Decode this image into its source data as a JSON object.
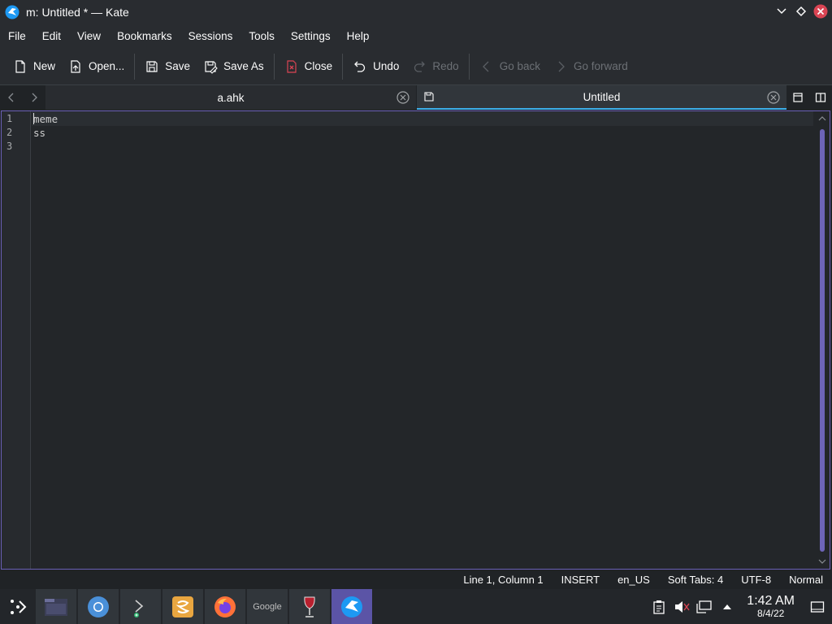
{
  "window": {
    "title": "m: Untitled * — Kate",
    "app_icon": "kate-icon"
  },
  "menu": [
    "File",
    "Edit",
    "View",
    "Bookmarks",
    "Sessions",
    "Tools",
    "Settings",
    "Help"
  ],
  "toolbar": {
    "new_label": "New",
    "open_label": "Open...",
    "save_label": "Save",
    "save_as_label": "Save As",
    "close_label": "Close",
    "undo_label": "Undo",
    "redo_label": "Redo",
    "go_back_label": "Go back",
    "go_forward_label": "Go forward"
  },
  "tabs": [
    {
      "label": "a.ahk",
      "active": false
    },
    {
      "label": "Untitled",
      "active": true,
      "modified": true
    }
  ],
  "editor": {
    "line_numbers": [
      "1",
      "2",
      "3"
    ],
    "lines": [
      "meme",
      "ss",
      ""
    ]
  },
  "status": {
    "position": "Line 1, Column 1",
    "mode": "INSERT",
    "language": "en_US",
    "indent": "Soft Tabs: 4",
    "encoding": "UTF-8",
    "highlight": "Normal"
  },
  "taskbar": {
    "apps": [
      "file-manager-icon",
      "chromium-icon",
      "terminal-icon",
      "sublime-icon",
      "firefox-icon",
      "google-icon",
      "wine-icon",
      "kate-icon"
    ],
    "google_text": "Google",
    "clock_time": "1:42 AM",
    "clock_date": "8/4/22"
  },
  "colors": {
    "accent": "#3daee9",
    "active_task": "#5b54a6",
    "close_button": "#da4453"
  }
}
